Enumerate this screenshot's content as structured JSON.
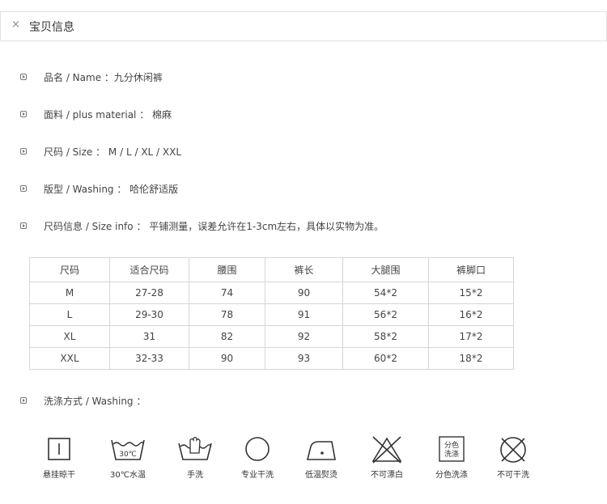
{
  "header": {
    "close_glyph": "×",
    "title": "宝贝信息"
  },
  "info": [
    {
      "label": "品名 / Name ：九分休闲裤"
    },
    {
      "label": "面料 / plus material ： 棉麻"
    },
    {
      "label": "尺码 / Size ： M / L / XL / XXL"
    },
    {
      "label": "版型 / Washing ： 哈伦舒适版"
    },
    {
      "label": "尺码信息 / Size info ： 平铺测量，误差允许在1-3cm左右，具体以实物为准。"
    }
  ],
  "size_table": {
    "headers": [
      "尺码",
      "适合尺码",
      "腰围",
      "裤长",
      "大腿围",
      "裤脚口"
    ],
    "rows": [
      [
        "M",
        "27-28",
        "74",
        "90",
        "54*2",
        "15*2"
      ],
      [
        "L",
        "29-30",
        "78",
        "91",
        "56*2",
        "16*2"
      ],
      [
        "XL",
        "31",
        "82",
        "92",
        "58*2",
        "17*2"
      ],
      [
        "XXL",
        "32-33",
        "90",
        "93",
        "60*2",
        "18*2"
      ]
    ]
  },
  "washing": {
    "label": "洗涤方式 / Washing ：",
    "icons": [
      {
        "icon": "hang-dry-icon",
        "label": "悬挂晾干"
      },
      {
        "icon": "wash-30-icon",
        "tub_text": "30℃",
        "label": "30℃水温"
      },
      {
        "icon": "hand-wash-icon",
        "label": "手洗"
      },
      {
        "icon": "dry-clean-icon",
        "label": "专业干洗"
      },
      {
        "icon": "iron-low-icon",
        "label": "低温熨烫"
      },
      {
        "icon": "no-bleach-icon",
        "label": "不可漂白"
      },
      {
        "icon": "wash-separately-icon",
        "box_text": [
          "分色",
          "洗涤"
        ],
        "label": "分色洗涤"
      },
      {
        "icon": "no-dry-clean-icon",
        "label": "不可干洗"
      }
    ]
  }
}
